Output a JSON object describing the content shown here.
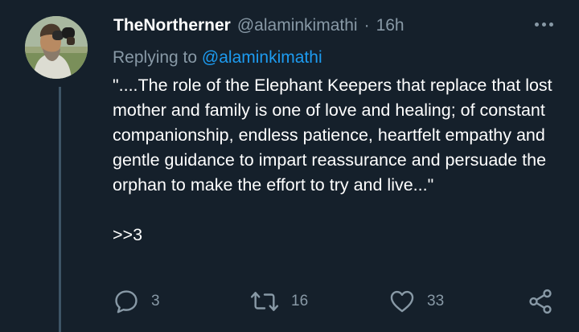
{
  "tweet": {
    "display_name": "TheNortherner",
    "handle": "@alaminkimathi",
    "separator": "·",
    "time": "16h",
    "replying_prefix": "Replying to",
    "replying_to": "@alaminkimathi",
    "body_lines": [
      "\"....The role of the Elephant Keepers that replace that lost mother and family is one of love and healing; of constant companionship, endless patience, heartfelt empathy and gentle guidance to impart reassurance and persuade the orphan to make the effort to try and live...\""
    ],
    "signoff": ">>3"
  },
  "actions": {
    "reply_count": "3",
    "retweet_count": "16",
    "like_count": "33"
  },
  "icons": {
    "reply": "reply-bubble-icon",
    "retweet": "retweet-arrows-icon",
    "like": "heart-icon",
    "share": "share-nodes-icon",
    "more": "more-dots-icon"
  },
  "colors": {
    "background": "#15202b",
    "secondary_text": "#8899a6",
    "link": "#1d9bf0",
    "thread_line": "#3d5466"
  }
}
